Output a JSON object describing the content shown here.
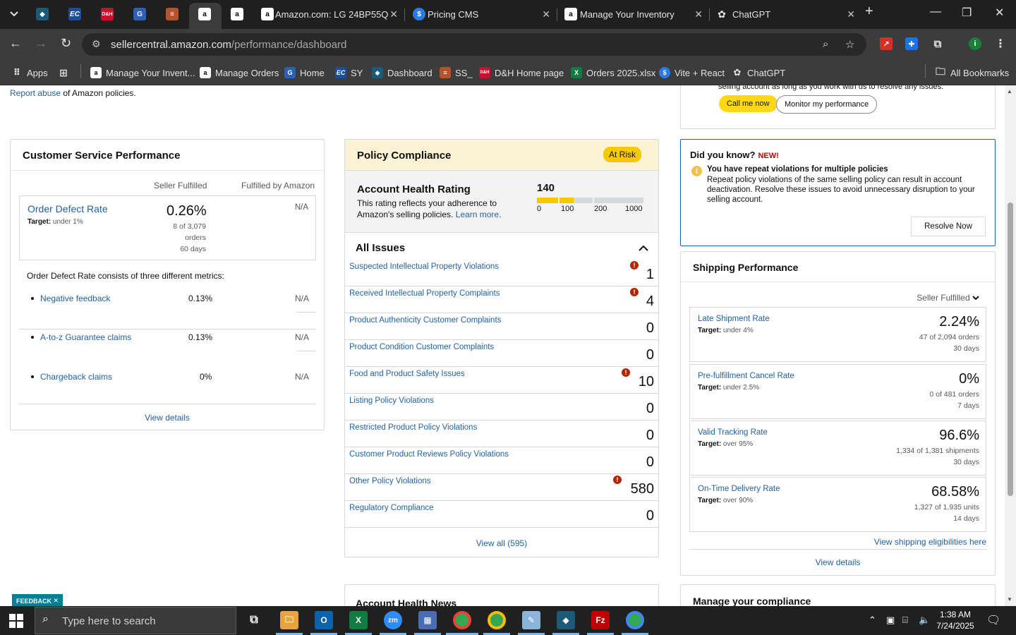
{
  "browser": {
    "tabs": [
      {
        "title": "Amazon.com: LG 24BP55Q"
      },
      {
        "title": "Pricing CMS"
      },
      {
        "title": "Manage Your Inventory"
      },
      {
        "title": "ChatGPT"
      }
    ],
    "url_host": "sellercentral.amazon.com",
    "url_path": "/performance/dashboard",
    "profile_initial": "i",
    "bookmarks": [
      {
        "label": "Apps"
      },
      {
        "label": "Manage Your Invent..."
      },
      {
        "label": "Manage Orders"
      },
      {
        "label": "Home"
      },
      {
        "label": "SY"
      },
      {
        "label": "Dashboard"
      },
      {
        "label": "SS_"
      },
      {
        "label": "D&H Home page"
      },
      {
        "label": "Orders 2025.xlsx"
      },
      {
        "label": "Vite + React"
      },
      {
        "label": "ChatGPT"
      }
    ],
    "all_bookmarks": "All Bookmarks"
  },
  "page": {
    "report_abuse_link": "Report abuse",
    "report_abuse_rest": " of Amazon policies.",
    "call_note": "selling account as long as you work with us to resolve any issues.",
    "call_me_now": "Call me now",
    "monitor_performance": "Monitor my performance",
    "customer_service": {
      "title": "Customer Service Performance",
      "col_seller": "Seller Fulfilled",
      "col_fba": "Fulfilled by Amazon",
      "odr_title": "Order Defect Rate",
      "odr_target_label": "Target:",
      "odr_target": " under 1%",
      "odr_value": "0.26%",
      "odr_count": "8 of 3,079",
      "odr_unit": "orders",
      "odr_period": "60 days",
      "odr_fba": "N/A",
      "consists_text": "Order Defect Rate consists of three different metrics:",
      "metrics": [
        {
          "name": "Negative feedback",
          "value": "0.13%",
          "fba": "N/A"
        },
        {
          "name": "A-to-z Guarantee claims",
          "value": "0.13%",
          "fba": "N/A"
        },
        {
          "name": "Chargeback claims",
          "value": "0%",
          "fba": "N/A"
        }
      ],
      "view_details": "View details"
    },
    "policy": {
      "title": "Policy Compliance",
      "status": "At Risk",
      "ahr_title": "Account Health Rating",
      "ahr_desc": "This rating reflects your adherence to Amazon's selling policies.",
      "ahr_learn_more": "Learn more.",
      "ahr_score": "140",
      "ahr_ticks": [
        "0",
        "100",
        "200",
        "1000"
      ],
      "issues_title": "All Issues",
      "issues": [
        {
          "name": "Suspected Intellectual Property Violations",
          "count": "1",
          "alert": true
        },
        {
          "name": "Received Intellectual Property Complaints",
          "count": "4",
          "alert": true
        },
        {
          "name": "Product Authenticity Customer Complaints",
          "count": "0",
          "alert": false
        },
        {
          "name": "Product Condition Customer Complaints",
          "count": "0",
          "alert": false
        },
        {
          "name": "Food and Product Safety Issues",
          "count": "10",
          "alert": true
        },
        {
          "name": "Listing Policy Violations",
          "count": "0",
          "alert": false
        },
        {
          "name": "Restricted Product Policy Violations",
          "count": "0",
          "alert": false
        },
        {
          "name": "Customer Product Reviews Policy Violations",
          "count": "0",
          "alert": false
        },
        {
          "name": "Other Policy Violations",
          "count": "580",
          "alert": true
        },
        {
          "name": "Regulatory Compliance",
          "count": "0",
          "alert": false
        }
      ],
      "view_all": "View all (595)"
    },
    "did_you_know": {
      "title": "Did you know?",
      "new_badge": "NEW!",
      "headline": "You have repeat violations for multiple policies",
      "body": "Repeat policy violations of the same selling policy can result in account deactivation. Resolve these issues to avoid unnecessary disruption to your selling account.",
      "resolve": "Resolve Now"
    },
    "shipping": {
      "title": "Shipping Performance",
      "filter": "Seller Fulfilled",
      "metrics": [
        {
          "name": "Late Shipment Rate",
          "target": " under 4%",
          "value": "2.24%",
          "sub1": "47 of 2,094 orders",
          "sub2": "30 days"
        },
        {
          "name": "Pre-fulfillment Cancel Rate",
          "target": " under 2.5%",
          "value": "0%",
          "sub1": "0 of 481 orders",
          "sub2": "7 days"
        },
        {
          "name": "Valid Tracking Rate",
          "target": " over 95%",
          "value": "96.6%",
          "sub1": "1,334 of 1,381 shipments",
          "sub2": "30 days"
        },
        {
          "name": "On-Time Delivery Rate",
          "target": " over 90%",
          "value": "68.58%",
          "sub1": "1,327 of 1,935 units",
          "sub2": "14 days"
        }
      ],
      "target_label": "Target:",
      "eligibilities": "View shipping eligibilities here",
      "view_details": "View details"
    },
    "account_health_news": "Account Health News",
    "manage_compliance": "Manage your compliance",
    "feedback": "FEEDBACK"
  },
  "taskbar": {
    "search_placeholder": "Type here to search",
    "time": "1:38 AM",
    "date": "7/24/2025"
  }
}
